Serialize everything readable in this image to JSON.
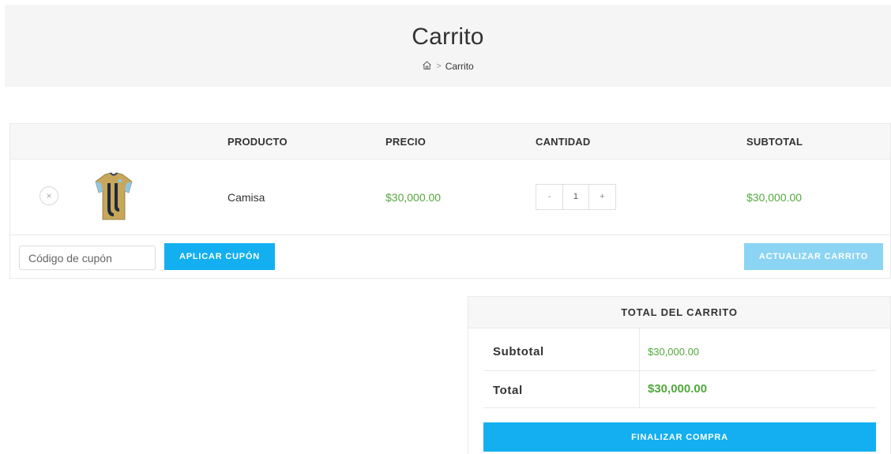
{
  "header": {
    "title": "Carrito",
    "breadcrumb": {
      "home_icon": "home-icon",
      "separator": ">",
      "current": "Carrito"
    }
  },
  "cart": {
    "columns": [
      "PRODUCTO",
      "PRECIO",
      "CANTIDAD",
      "SUBTOTAL"
    ],
    "items": [
      {
        "remove_symbol": "×",
        "thumbnail": "tshirt-thumbnail",
        "name": "Camisa",
        "price": "$30,000.00",
        "quantity": "1",
        "minus": "-",
        "plus": "+",
        "subtotal": "$30,000.00"
      }
    ],
    "coupon_placeholder": "Código de cupón",
    "apply_coupon_label": "Aplicar cupón",
    "update_cart_label": "Actualizar carrito"
  },
  "totals": {
    "title": "TOTAL DEL CARRITO",
    "subtotal_label": "Subtotal",
    "subtotal_value": "$30,000.00",
    "total_label": "Total",
    "total_value": "$30,000.00",
    "checkout_label": "Finalizar compra"
  },
  "colors": {
    "accent": "#13aff0",
    "accent_disabled": "#8bd4f3",
    "price_green": "#52a83c",
    "header_bg": "#f5f5f5"
  }
}
